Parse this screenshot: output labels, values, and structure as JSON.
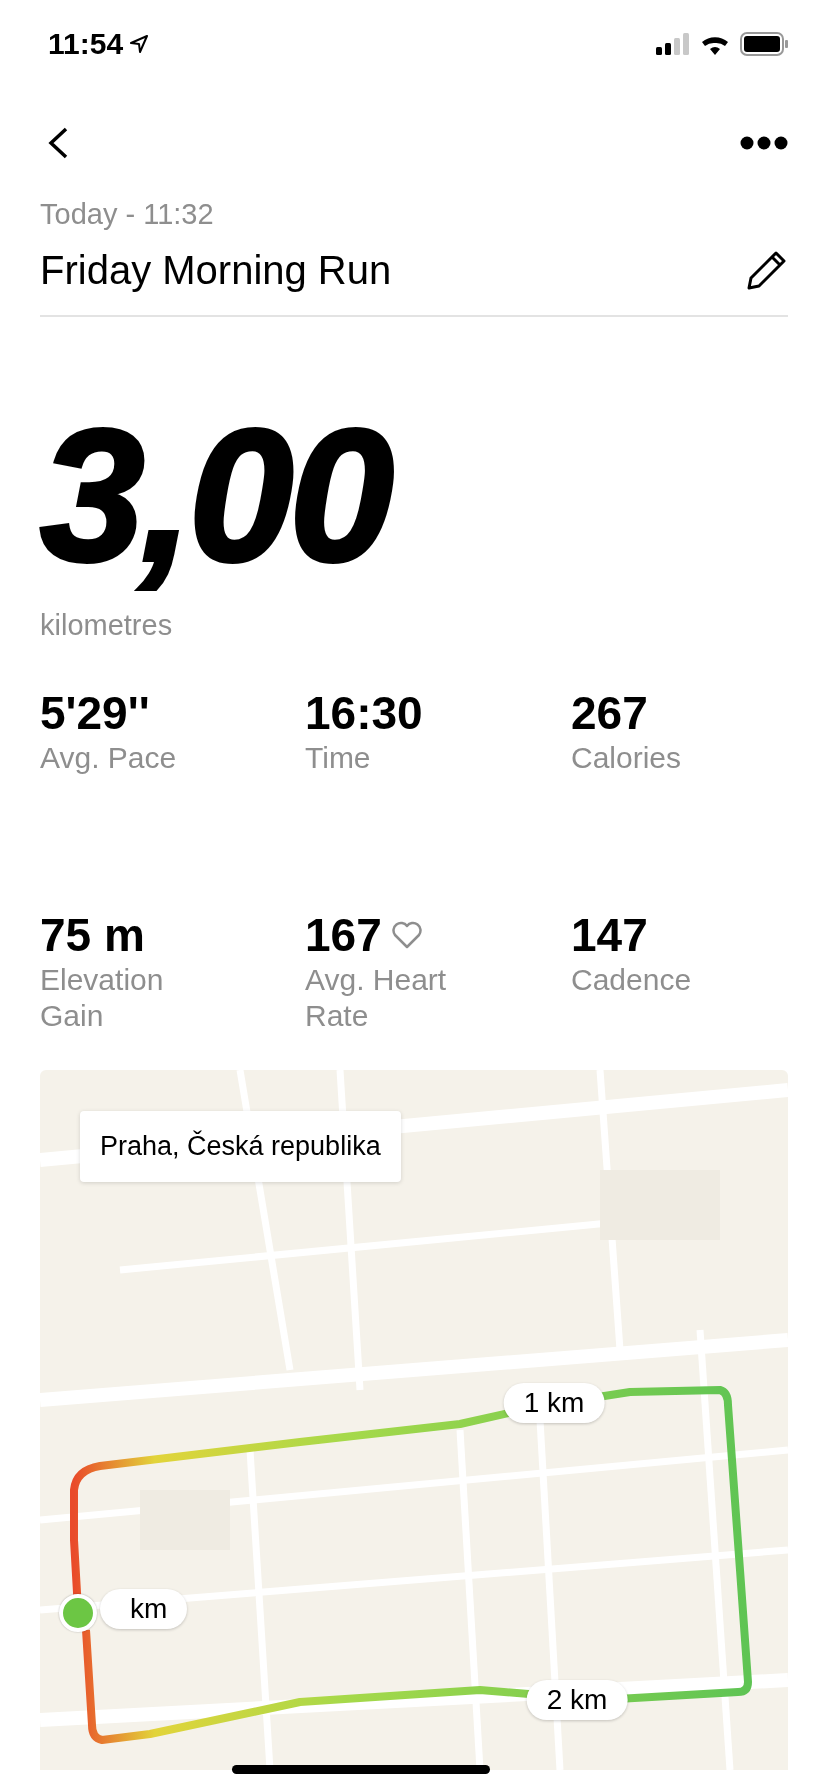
{
  "status_bar": {
    "time": "11:54"
  },
  "header": {
    "date": "Today - 11:32",
    "title": "Friday Morning Run"
  },
  "distance": {
    "value": "3,00",
    "unit": "kilometres"
  },
  "stats": [
    {
      "value": "5'29''",
      "label": "Avg. Pace",
      "heart": false
    },
    {
      "value": "16:30",
      "label": "Time",
      "heart": false
    },
    {
      "value": "267",
      "label": "Calories",
      "heart": false
    },
    {
      "value": "75 m",
      "label": "Elevation Gain",
      "heart": false
    },
    {
      "value": "167",
      "label": "Avg. Heart Rate",
      "heart": true
    },
    {
      "value": "147",
      "label": "Cadence",
      "heart": false
    }
  ],
  "map": {
    "kind": "picture",
    "location": "Praha, Česká republika",
    "markers": [
      {
        "label": "km",
        "kind": "start"
      },
      {
        "label": "1 km",
        "kind": "split"
      },
      {
        "label": "2 km",
        "kind": "split"
      }
    ]
  }
}
